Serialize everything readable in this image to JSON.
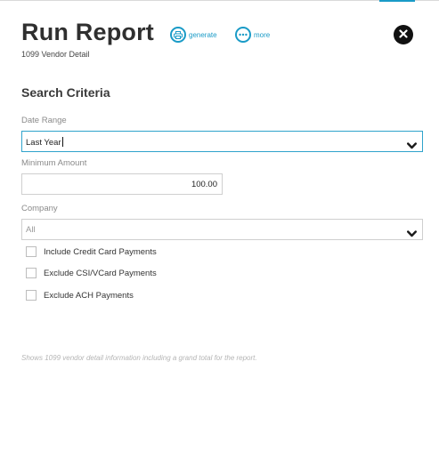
{
  "header": {
    "title": "Run Report",
    "subtitle": "1099 Vendor Detail",
    "actions": [
      {
        "label": "generate",
        "icon": "printer-icon"
      },
      {
        "label": "more",
        "icon": "ellipsis-icon"
      }
    ],
    "close_icon": "close-icon"
  },
  "search": {
    "section_title": "Search Criteria",
    "date_range": {
      "label": "Date Range",
      "value": "Last Year"
    },
    "minimum_amount": {
      "label": "Minimum Amount",
      "value": "100.00"
    },
    "company": {
      "label": "Company",
      "value": "All"
    },
    "checkboxes": [
      {
        "label": "Include Credit Card Payments",
        "checked": false
      },
      {
        "label": "Exclude CSI/VCard Payments",
        "checked": false
      },
      {
        "label": "Exclude ACH Payments",
        "checked": false
      }
    ]
  },
  "description": "Shows 1099 vendor detail information including a grand total for the report.",
  "colors": {
    "accent": "#1a9bc7",
    "close": "#111111",
    "hint": "#b5b5b5"
  }
}
